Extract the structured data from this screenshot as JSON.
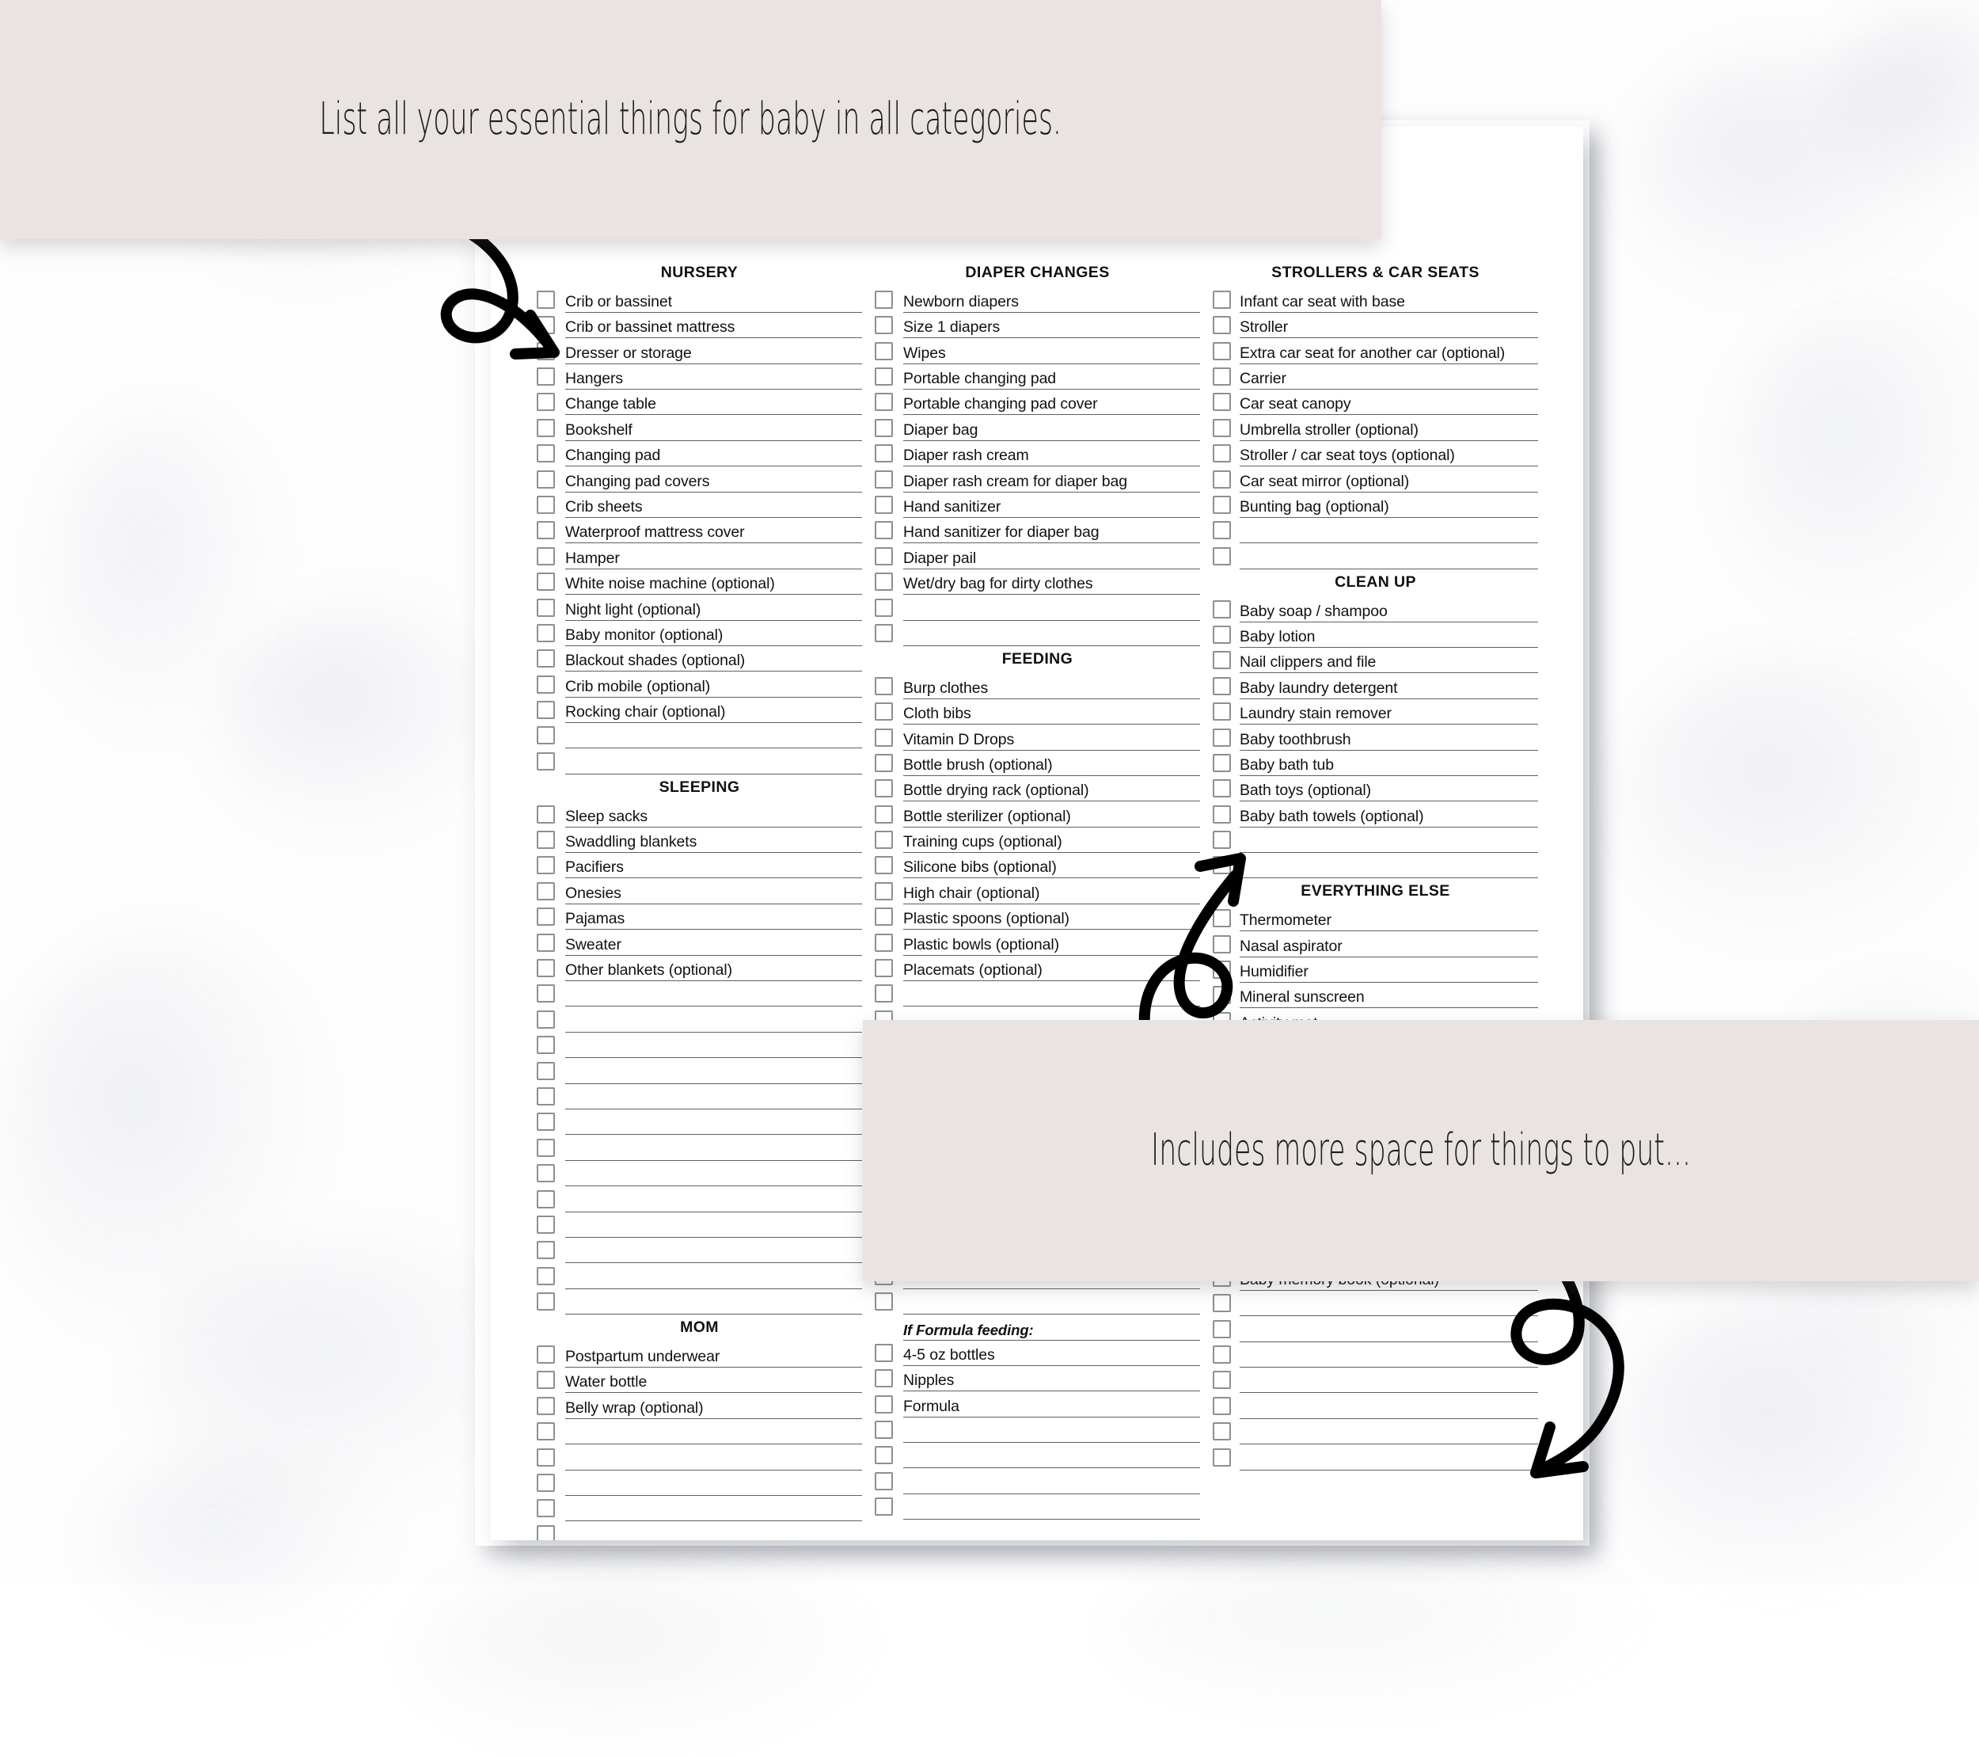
{
  "background": {
    "surface": "white-marble",
    "paper_color": "#ffffff",
    "callout_color": "#e9e3e2",
    "ink_color": "#111111",
    "rule_color": "#5d6064",
    "checkbox_border": "#8c8f93"
  },
  "callouts": [
    {
      "id": "callout-top",
      "text": "List all your essential things for baby in all categories."
    },
    {
      "id": "callout-bottom",
      "text": "Includes more space for things to put..."
    }
  ],
  "arrows": [
    {
      "name": "arrow-to-nursery",
      "direction": "down-right"
    },
    {
      "name": "arrow-to-clean-up",
      "direction": "up-right"
    },
    {
      "name": "arrow-to-blank-lines",
      "direction": "down-left"
    }
  ],
  "checklist": {
    "columns": [
      {
        "name": "column-left",
        "sections": [
          {
            "title": "NURSERY",
            "items": [
              "Crib or bassinet",
              "Crib or bassinet mattress",
              "Dresser or storage",
              "Hangers",
              "Change table",
              "Bookshelf",
              "Changing pad",
              "Changing pad covers",
              "Crib sheets",
              "Waterproof mattress cover",
              "Hamper",
              "White noise machine (optional)",
              "Night light (optional)",
              "Baby monitor (optional)",
              "Blackout shades (optional)",
              "Crib mobile (optional)",
              "Rocking chair (optional)"
            ],
            "blank_rows": 2
          },
          {
            "title": "SLEEPING",
            "items": [
              "Sleep sacks",
              "Swaddling blankets",
              "Pacifiers",
              "Onesies",
              "Pajamas",
              "Sweater",
              "Other blankets (optional)"
            ],
            "blank_rows": 2
          },
          {
            "title": "",
            "items": [],
            "blank_rows": 11
          },
          {
            "title": "MOM",
            "items": [
              "Postpartum underwear",
              "Water bottle",
              "Belly wrap (optional)"
            ],
            "blank_rows": 5
          }
        ]
      },
      {
        "name": "column-middle",
        "sections": [
          {
            "title": "DIAPER CHANGES",
            "items": [
              "Newborn diapers",
              "Size 1 diapers",
              "Wipes",
              "Portable changing pad",
              "Portable changing pad cover",
              "Diaper bag",
              "Diaper rash cream",
              "Diaper rash cream for diaper bag",
              "Hand sanitizer",
              "Hand sanitizer for diaper bag",
              "Diaper pail",
              "Wet/dry bag for dirty clothes"
            ],
            "blank_rows": 2
          },
          {
            "title": "FEEDING",
            "items": [
              "Burp clothes",
              "Cloth bibs",
              "Vitamin D Drops",
              "Bottle brush (optional)",
              "Bottle drying rack (optional)",
              "Bottle sterilizer (optional)",
              "Training cups (optional)",
              "Silicone bibs (optional)",
              "High chair (optional)",
              "Plastic spoons (optional)",
              "Plastic bowls (optional)",
              "Placemats (optional)"
            ],
            "blank_rows": 2
          },
          {
            "title": "",
            "items": [],
            "blank_rows": 11
          },
          {
            "title": "",
            "note": "If Formula feeding:",
            "items": [
              "4-5 oz bottles",
              "Nipples",
              "Formula"
            ],
            "blank_rows": 4
          }
        ]
      },
      {
        "name": "column-right",
        "sections": [
          {
            "title": "STROLLERS & CAR SEATS",
            "items": [
              "Infant car seat with base",
              "Stroller",
              "Extra car seat for another car (optional)",
              "Carrier",
              "Car seat canopy",
              "Umbrella stroller (optional)",
              "Stroller / car seat toys (optional)",
              "Car seat mirror (optional)",
              "Bunting bag (optional)"
            ],
            "blank_rows": 2
          },
          {
            "title": "CLEAN UP",
            "items": [
              "Baby soap / shampoo",
              "Baby lotion",
              "Nail clippers and file",
              "Baby laundry detergent",
              "Laundry stain remover",
              "Baby toothbrush",
              "Baby bath tub",
              "Bath toys (optional)",
              "Baby bath towels (optional)"
            ],
            "blank_rows": 2
          },
          {
            "title": "EVERYTHING ELSE",
            "items": [
              "Thermometer",
              "Nasal aspirator",
              "Humidifier",
              "Mineral sunscreen",
              "Activity mat"
            ],
            "blank_rows": 9
          },
          {
            "title": "",
            "items": [
              "Baby memory book (optional)"
            ],
            "blank_rows": 7
          }
        ]
      }
    ]
  }
}
